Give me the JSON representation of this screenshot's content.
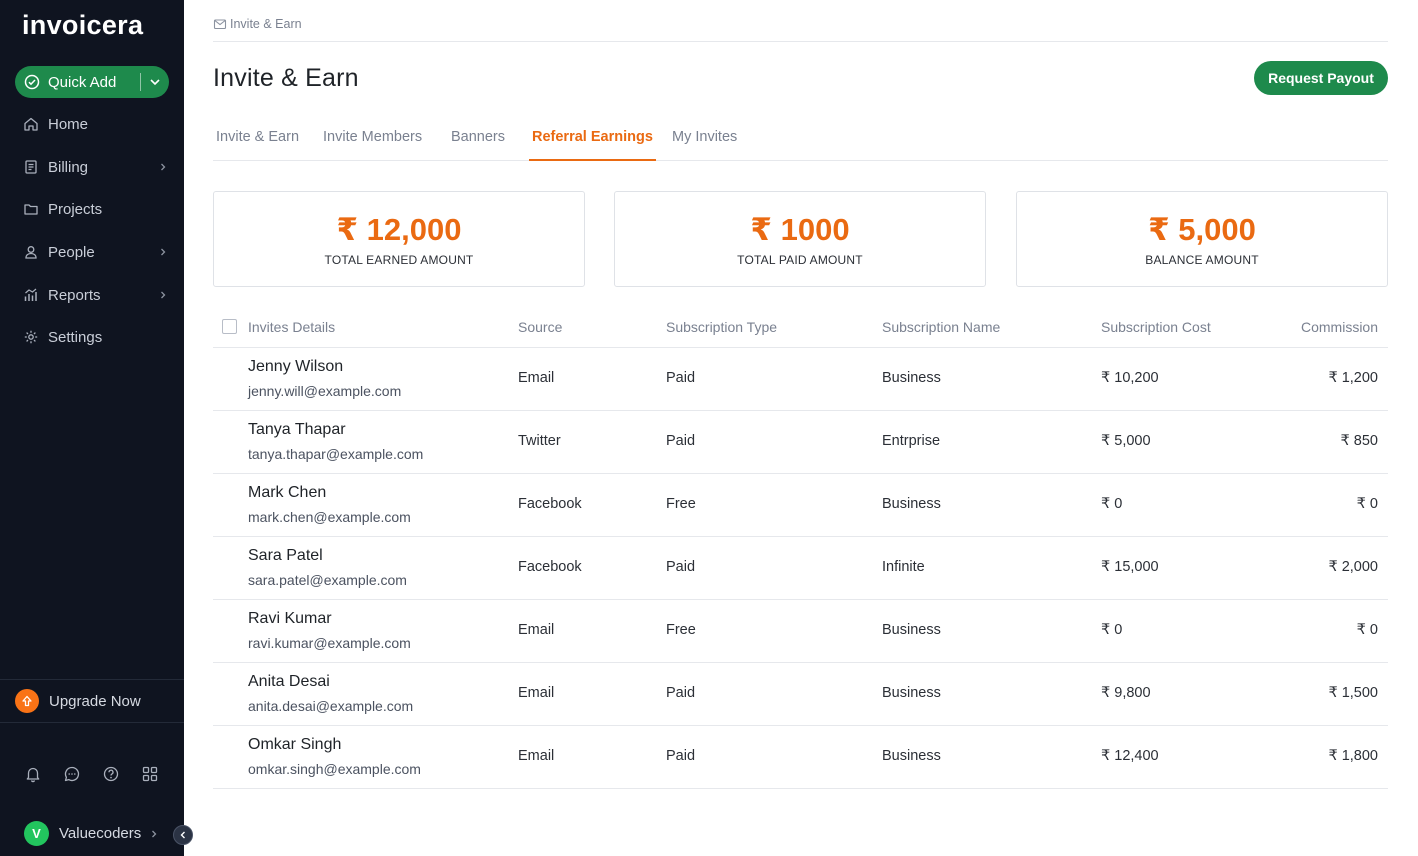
{
  "app": {
    "logo_text": "invoicera"
  },
  "sidebar": {
    "quick_add_label": "Quick Add",
    "items": [
      {
        "label": "Home",
        "icon": "home-icon",
        "has_submenu": false
      },
      {
        "label": "Billing",
        "icon": "billing-icon",
        "has_submenu": true
      },
      {
        "label": "Projects",
        "icon": "folder-icon",
        "has_submenu": false
      },
      {
        "label": "People",
        "icon": "person-icon",
        "has_submenu": true
      },
      {
        "label": "Reports",
        "icon": "bar-chart-icon",
        "has_submenu": true
      },
      {
        "label": "Settings",
        "icon": "gear-icon",
        "has_submenu": false
      }
    ],
    "upgrade_label": "Upgrade Now",
    "bottom_icons": [
      "bell-icon",
      "chat-icon",
      "help-icon",
      "apps-grid-icon"
    ],
    "user": {
      "initial": "V",
      "name": "Valuecoders"
    }
  },
  "header": {
    "breadcrumb": "Invite & Earn",
    "title": "Invite & Earn",
    "payout_button": "Request Payout"
  },
  "tabs": [
    {
      "label": "Invite & Earn",
      "active": false
    },
    {
      "label": "Invite Members",
      "active": false
    },
    {
      "label": "Banners",
      "active": false
    },
    {
      "label": "Referral Earnings",
      "active": true
    },
    {
      "label": "My Invites",
      "active": false
    }
  ],
  "cards": [
    {
      "amount": "₹ 12,000",
      "label": "TOTAL EARNED AMOUNT"
    },
    {
      "amount": "₹ 1000",
      "label": "TOTAL PAID AMOUNT"
    },
    {
      "amount": "₹ 5,000",
      "label": "BALANCE AMOUNT"
    }
  ],
  "table": {
    "columns": [
      "Invites Details",
      "Source",
      "Subscription Type",
      "Subscription Name",
      "Subscription Cost",
      "Commission"
    ],
    "rows": [
      {
        "name": "Jenny Wilson",
        "email": "jenny.will@example.com",
        "source": "Email",
        "type": "Paid",
        "plan": "Business",
        "cost": "₹ 10,200",
        "commission": "₹ 1,200"
      },
      {
        "name": "Tanya Thapar",
        "email": "tanya.thapar@example.com",
        "source": "Twitter",
        "type": "Paid",
        "plan": "Entrprise",
        "cost": "₹ 5,000",
        "commission": "₹ 850"
      },
      {
        "name": "Mark Chen",
        "email": "mark.chen@example.com",
        "source": "Facebook",
        "type": "Free",
        "plan": "Business",
        "cost": "₹ 0",
        "commission": "₹ 0"
      },
      {
        "name": "Sara Patel",
        "email": "sara.patel@example.com",
        "source": "Facebook",
        "type": "Paid",
        "plan": "Infinite",
        "cost": "₹ 15,000",
        "commission": "₹ 2,000"
      },
      {
        "name": "Ravi Kumar",
        "email": "ravi.kumar@example.com",
        "source": "Email",
        "type": "Free",
        "plan": "Business",
        "cost": "₹ 0",
        "commission": "₹ 0"
      },
      {
        "name": "Anita Desai",
        "email": "anita.desai@example.com",
        "source": "Email",
        "type": "Paid",
        "plan": "Business",
        "cost": "₹ 9,800",
        "commission": "₹ 1,500"
      },
      {
        "name": "Omkar Singh",
        "email": "omkar.singh@example.com",
        "source": "Email",
        "type": "Paid",
        "plan": "Business",
        "cost": "₹ 12,400",
        "commission": "₹ 1,800"
      }
    ]
  },
  "colors": {
    "sidebar_bg": "#0f1420",
    "brand_green": "#1e8a4c",
    "accent_orange": "#ea6a12",
    "avatar_green": "#22c55e"
  }
}
